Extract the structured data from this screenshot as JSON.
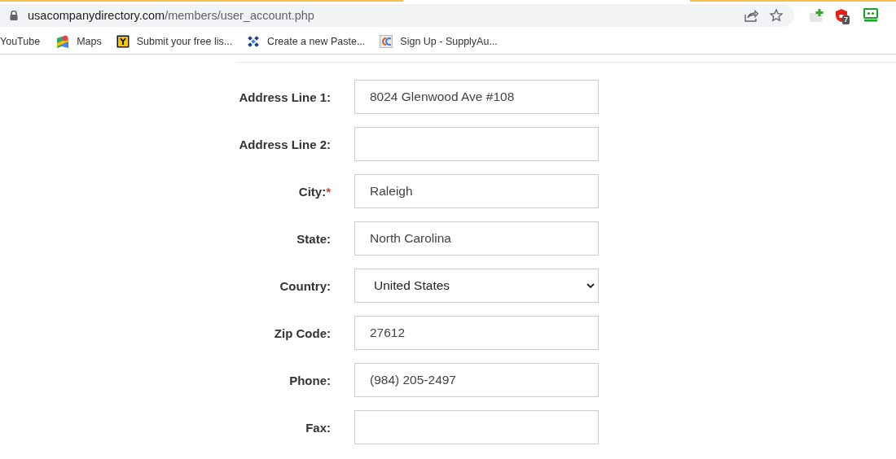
{
  "browser": {
    "url": {
      "host": "usacompanydirectory.com",
      "path": "/members/user_account.php"
    },
    "extension_badge": "7"
  },
  "bookmarks": [
    {
      "label": "YouTube"
    },
    {
      "label": "Maps"
    },
    {
      "label": "Submit your free lis..."
    },
    {
      "label": "Create a new Paste..."
    },
    {
      "label": "Sign Up - SupplyAu..."
    }
  ],
  "form": {
    "fields": [
      {
        "label": "Address Line 1:",
        "kind": "text",
        "value": "8024 Glenwood Ave #108"
      },
      {
        "label": "Address Line 2:",
        "kind": "text"
      },
      {
        "label": "City:",
        "kind": "text",
        "mark": "*",
        "value": "Raleigh"
      },
      {
        "label": "State:",
        "kind": "text",
        "value": "North Carolina"
      },
      {
        "label": "Country:",
        "kind": "select",
        "value": "United States"
      },
      {
        "label": "Zip Code:",
        "kind": "text",
        "value": "27612"
      },
      {
        "label": "Phone:",
        "kind": "text",
        "value": "(984) 205-2497"
      },
      {
        "label": "Fax:",
        "kind": "text"
      }
    ]
  }
}
